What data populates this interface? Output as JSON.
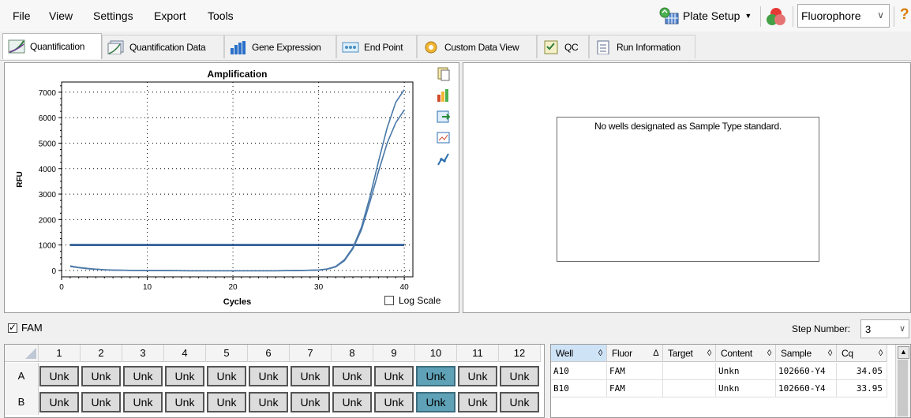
{
  "menu": {
    "file": "File",
    "view": "View",
    "settings": "Settings",
    "export": "Export",
    "tools": "Tools"
  },
  "toolbar": {
    "plate_setup": "Plate Setup",
    "mode_select": "Fluorophore",
    "help": "?"
  },
  "tabs": [
    {
      "label": "Quantification",
      "icon": "amplification-curve-icon"
    },
    {
      "label": "Quantification Data",
      "icon": "quantification-data-icon"
    },
    {
      "label": "Gene Expression",
      "icon": "bar-chart-icon"
    },
    {
      "label": "End Point",
      "icon": "end-point-icon"
    },
    {
      "label": "Custom Data View",
      "icon": "gear-icon"
    },
    {
      "label": "QC",
      "icon": "qc-checklist-icon"
    },
    {
      "label": "Run Information",
      "icon": "document-icon"
    }
  ],
  "chart_data": {
    "type": "line",
    "title": "Amplification",
    "xlabel": "Cycles",
    "ylabel": "RFU",
    "xlim": [
      0,
      41
    ],
    "ylim": [
      -250,
      7400
    ],
    "x_ticks": [
      0,
      10,
      20,
      30,
      40
    ],
    "y_ticks": [
      0,
      1000,
      2000,
      3000,
      4000,
      5000,
      6000,
      7000
    ],
    "grid": true,
    "threshold": 1000,
    "series": [
      {
        "x": [
          1,
          2,
          3,
          4,
          5,
          6,
          8,
          10,
          12,
          15,
          20,
          25,
          28,
          30,
          31,
          32,
          33,
          34,
          35,
          36,
          37,
          38,
          39,
          40
        ],
        "y": [
          180,
          120,
          80,
          50,
          30,
          15,
          5,
          0,
          -5,
          -10,
          -12,
          -10,
          0,
          20,
          60,
          160,
          420,
          900,
          1700,
          2900,
          4300,
          5600,
          6600,
          7100
        ]
      },
      {
        "x": [
          1,
          2,
          3,
          4,
          5,
          6,
          8,
          10,
          12,
          15,
          20,
          25,
          28,
          30,
          31,
          32,
          33,
          34,
          35,
          36,
          37,
          38,
          39,
          40
        ],
        "y": [
          160,
          110,
          70,
          45,
          25,
          12,
          4,
          0,
          -5,
          -10,
          -12,
          -10,
          0,
          15,
          50,
          140,
          380,
          850,
          1600,
          2700,
          3900,
          5000,
          5800,
          6300
        ]
      }
    ]
  },
  "chart_icons": [
    "copy-icon",
    "chart-settings-icon",
    "export-icon",
    "zoom-icon",
    "curve-fit-icon"
  ],
  "log_scale_label": "Log Scale",
  "side_message": "No wells designated as Sample Type standard.",
  "fluor_label": "FAM",
  "step_number_label": "Step Number:",
  "step_number_value": "3",
  "plate": {
    "columns": [
      "1",
      "2",
      "3",
      "4",
      "5",
      "6",
      "7",
      "8",
      "9",
      "10",
      "11",
      "12"
    ],
    "rows": [
      {
        "label": "A",
        "wells": [
          "Unk",
          "Unk",
          "Unk",
          "Unk",
          "Unk",
          "Unk",
          "Unk",
          "Unk",
          "Unk",
          "Unk",
          "Unk",
          "Unk"
        ]
      },
      {
        "label": "B",
        "wells": [
          "Unk",
          "Unk",
          "Unk",
          "Unk",
          "Unk",
          "Unk",
          "Unk",
          "Unk",
          "Unk",
          "Unk",
          "Unk",
          "Unk"
        ]
      }
    ]
  },
  "table": {
    "headers": [
      "Well",
      "Fluor",
      "Target",
      "Content",
      "Sample",
      "Cq"
    ],
    "rows": [
      [
        "A10",
        "FAM",
        "",
        "Unkn",
        "102660-Y4",
        "34.05"
      ],
      [
        "B10",
        "FAM",
        "",
        "Unkn",
        "102660-Y4",
        "33.95"
      ]
    ]
  },
  "colors": {
    "curve": "#4a78a8",
    "threshold": "#1f4e8c",
    "selected_well": "#5fa2b8"
  }
}
